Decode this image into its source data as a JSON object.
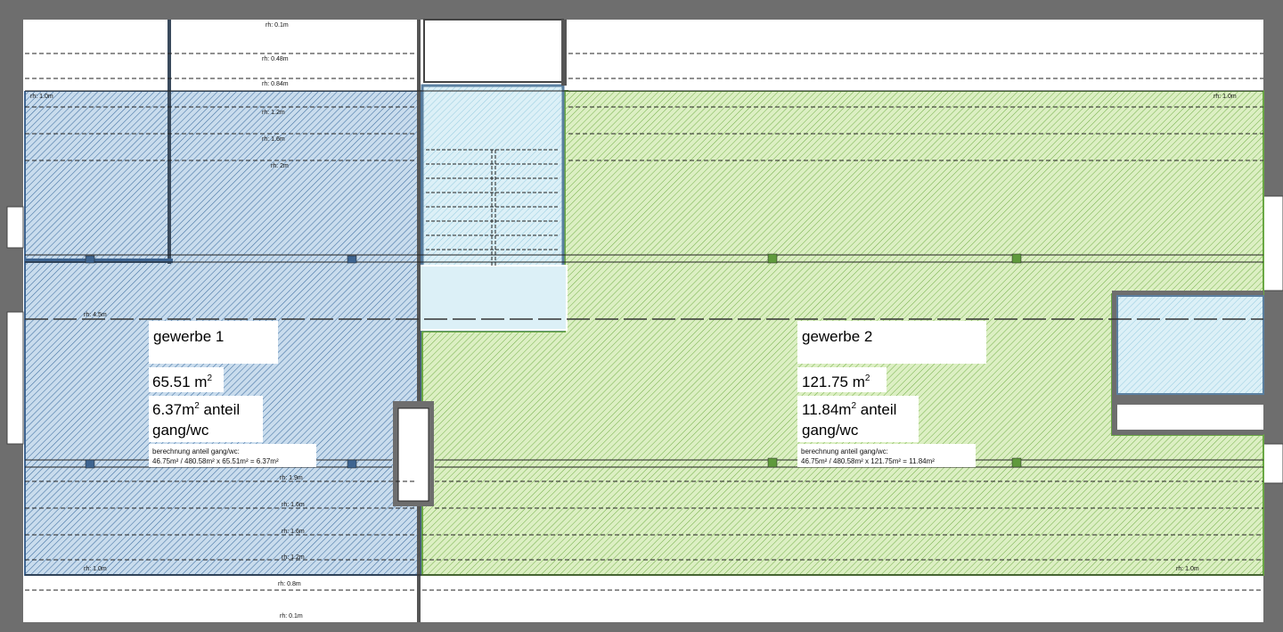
{
  "colors": {
    "wall": "#6e6e6e",
    "wall_dark": "#5a5a5a",
    "blue_fill": "#c9dced",
    "blue_hatch": "#3f6fa0",
    "blue_edge": "#3e6490",
    "green_fill": "#dcefc3",
    "green_hatch": "#74b04a",
    "green_edge": "#6aa844",
    "stair_fill": "#dcf0f7",
    "stair_hatch": "#8ec7dd",
    "line": "#222222"
  },
  "rooms": {
    "gewerbe1": {
      "name": "gewerbe 1",
      "area_num": "65.51 m",
      "area_sup": "2",
      "anteil_line1": "6.37m",
      "anteil_sup": "2",
      "anteil_rest": " anteil",
      "anteil_line2": "gang/wc",
      "calc_title": "berechnung anteil gang/wc:",
      "calc_formula": "46.75m² / 480.58m² x 65.51m² = 6.37m²"
    },
    "gewerbe2": {
      "name": "gewerbe 2",
      "area_num": "121.75 m",
      "area_sup": "2",
      "anteil_line1": "11.84m",
      "anteil_sup": "2",
      "anteil_rest": " anteil",
      "anteil_line2": "gang/wc",
      "calc_title": "berechnung anteil gang/wc:",
      "calc_formula": "46.75m² / 480.58m² x 121.75m² = 11.84m²"
    }
  },
  "height_labels": {
    "top_1": "rh: 0.1m",
    "top_2": "rh: 0.48m",
    "top_3": "rh: 0.84m",
    "left_1": "rh: 1.0m",
    "mid_1": "rh: 1.2m",
    "mid_2": "rh: 1.6m",
    "mid_3": "rh: 2m",
    "left_mid": "rh: 4.5m",
    "low_1": "rh: 1.9m",
    "low_2": "rh: 1.6m",
    "low_3": "rh: 1.6m",
    "low_4": "rh: 1.2m",
    "left_bottom": "rh: 1.0m",
    "right_top": "rh: 1.0m",
    "right_bottom": "rh: 1.0m",
    "bottom_1": "rh: 0.8m",
    "bottom_2": "rh: 0.1m"
  }
}
